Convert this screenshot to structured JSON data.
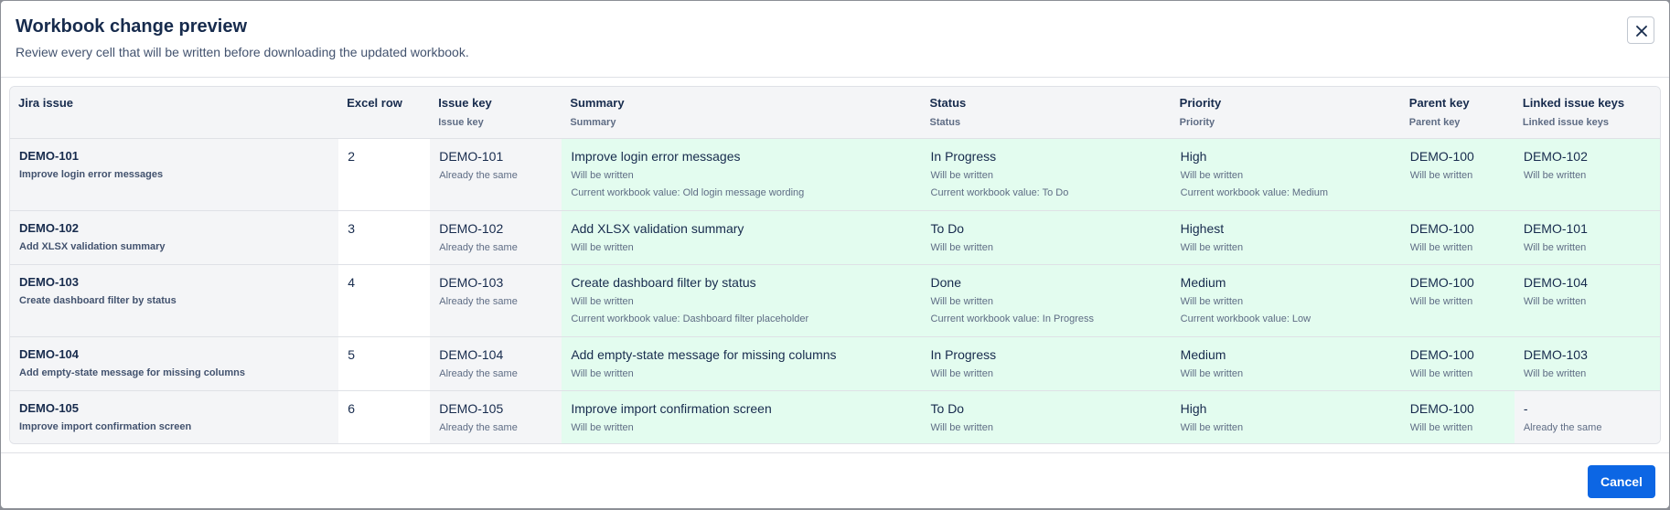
{
  "dialog": {
    "title": "Workbook change preview",
    "subtitle": "Review every cell that will be written before downloading the updated workbook.",
    "close_icon": "close-icon",
    "cancel_label": "Cancel"
  },
  "colors": {
    "write_bg": "#e3fcef",
    "same_bg": "#f4f5f7",
    "primary": "#0c66e4"
  },
  "table": {
    "headers": [
      {
        "label": "Jira issue",
        "sub": ""
      },
      {
        "label": "Excel row",
        "sub": ""
      },
      {
        "label": "Issue key",
        "sub": "Issue key"
      },
      {
        "label": "Summary",
        "sub": "Summary"
      },
      {
        "label": "Status",
        "sub": "Status"
      },
      {
        "label": "Priority",
        "sub": "Priority"
      },
      {
        "label": "Parent key",
        "sub": "Parent key"
      },
      {
        "label": "Linked issue keys",
        "sub": "Linked issue keys"
      }
    ],
    "rows": [
      {
        "jira": {
          "key": "DEMO-101",
          "title": "Improve login error messages"
        },
        "excel_row": "2",
        "issue_key": {
          "value": "DEMO-101",
          "note": "Already the same"
        },
        "summary": {
          "value": "Improve login error messages",
          "note": "Will be written",
          "current": "Current workbook value: Old login message wording"
        },
        "status": {
          "value": "In Progress",
          "note": "Will be written",
          "current": "Current workbook value: To Do"
        },
        "priority": {
          "value": "High",
          "note": "Will be written",
          "current": "Current workbook value: Medium"
        },
        "parent": {
          "value": "DEMO-100",
          "note": "Will be written"
        },
        "linked": {
          "value": "DEMO-102",
          "note": "Will be written"
        }
      },
      {
        "jira": {
          "key": "DEMO-102",
          "title": "Add XLSX validation summary"
        },
        "excel_row": "3",
        "issue_key": {
          "value": "DEMO-102",
          "note": "Already the same"
        },
        "summary": {
          "value": "Add XLSX validation summary",
          "note": "Will be written"
        },
        "status": {
          "value": "To Do",
          "note": "Will be written"
        },
        "priority": {
          "value": "Highest",
          "note": "Will be written"
        },
        "parent": {
          "value": "DEMO-100",
          "note": "Will be written"
        },
        "linked": {
          "value": "DEMO-101",
          "note": "Will be written"
        }
      },
      {
        "jira": {
          "key": "DEMO-103",
          "title": "Create dashboard filter by status"
        },
        "excel_row": "4",
        "issue_key": {
          "value": "DEMO-103",
          "note": "Already the same"
        },
        "summary": {
          "value": "Create dashboard filter by status",
          "note": "Will be written",
          "current": "Current workbook value: Dashboard filter placeholder"
        },
        "status": {
          "value": "Done",
          "note": "Will be written",
          "current": "Current workbook value: In Progress"
        },
        "priority": {
          "value": "Medium",
          "note": "Will be written",
          "current": "Current workbook value: Low"
        },
        "parent": {
          "value": "DEMO-100",
          "note": "Will be written"
        },
        "linked": {
          "value": "DEMO-104",
          "note": "Will be written"
        }
      },
      {
        "jira": {
          "key": "DEMO-104",
          "title": "Add empty-state message for missing columns"
        },
        "excel_row": "5",
        "issue_key": {
          "value": "DEMO-104",
          "note": "Already the same"
        },
        "summary": {
          "value": "Add empty-state message for missing columns",
          "note": "Will be written"
        },
        "status": {
          "value": "In Progress",
          "note": "Will be written"
        },
        "priority": {
          "value": "Medium",
          "note": "Will be written"
        },
        "parent": {
          "value": "DEMO-100",
          "note": "Will be written"
        },
        "linked": {
          "value": "DEMO-103",
          "note": "Will be written"
        }
      },
      {
        "jira": {
          "key": "DEMO-105",
          "title": "Improve import confirmation screen"
        },
        "excel_row": "6",
        "issue_key": {
          "value": "DEMO-105",
          "note": "Already the same"
        },
        "summary": {
          "value": "Improve import confirmation screen",
          "note": "Will be written"
        },
        "status": {
          "value": "To Do",
          "note": "Will be written"
        },
        "priority": {
          "value": "High",
          "note": "Will be written"
        },
        "parent": {
          "value": "DEMO-100",
          "note": "Will be written"
        },
        "linked": {
          "value": "-",
          "note": "Already the same"
        }
      }
    ]
  }
}
